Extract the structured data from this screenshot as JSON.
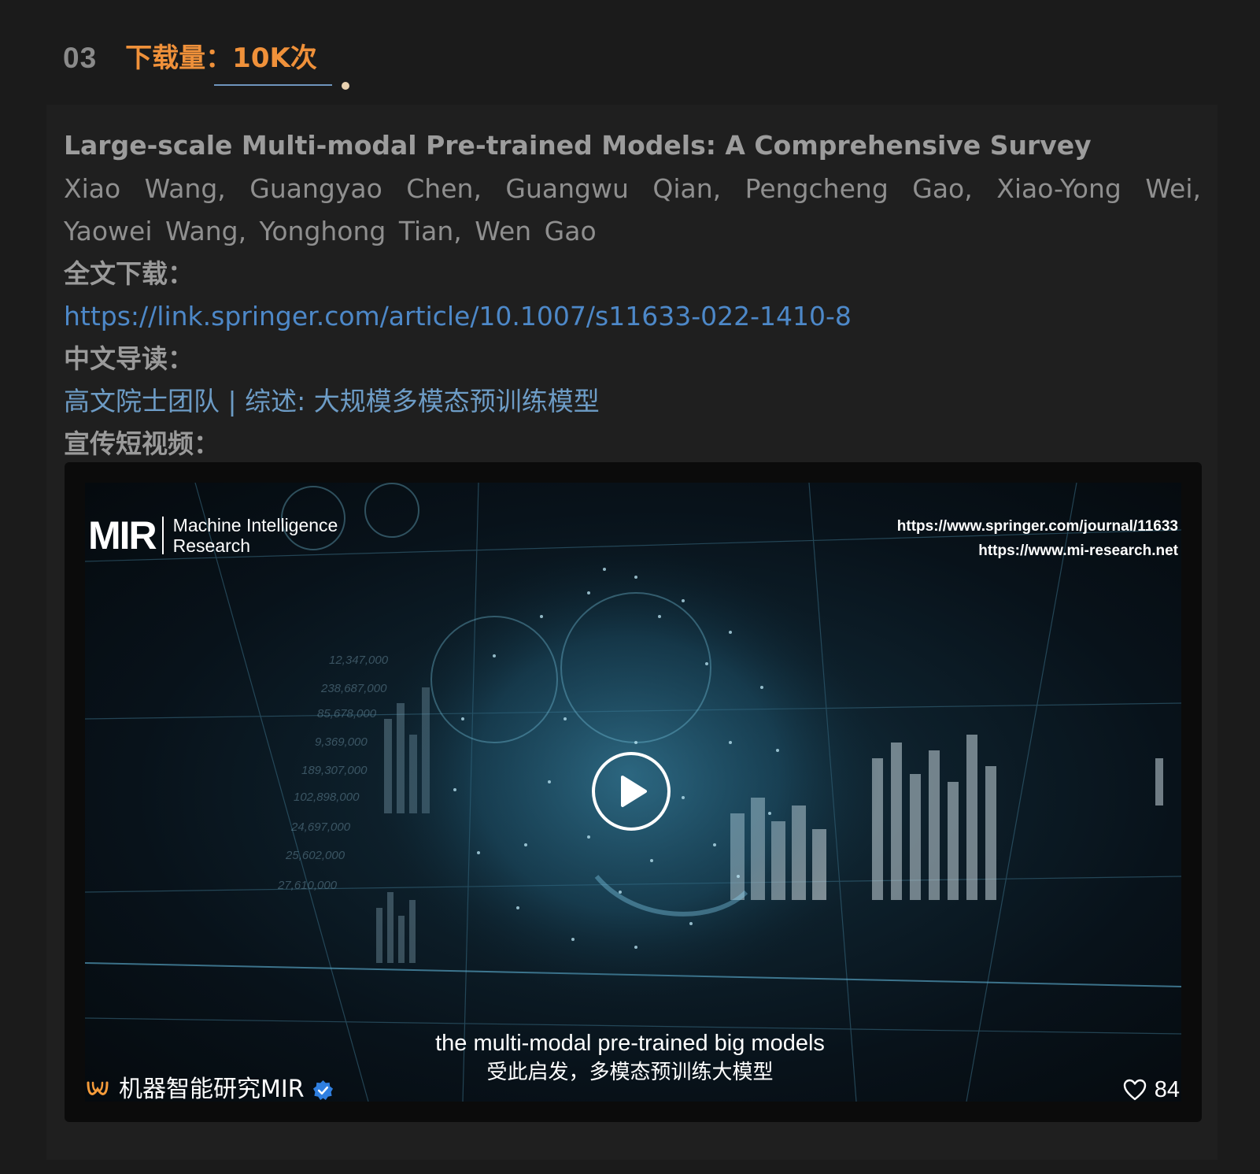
{
  "section": {
    "number": "03",
    "label": "下载量：",
    "value": "10K次"
  },
  "paper": {
    "title": "Large-scale Multi-modal Pre-trained Models: A Comprehensive Survey",
    "authors": "Xiao Wang, Guangyao Chen, Guangwu Qian, Pengcheng Gao, Xiao-Yong Wei, Yaowei Wang, Yonghong Tian, Wen Gao",
    "download_label": "全文下载：",
    "download_url": "https://link.springer.com/article/10.1007/s11633-022-1410-8",
    "guide_label": "中文导读：",
    "guide_text": "高文院士团队 | 综述: 大规模多模态预训练模型",
    "video_label": "宣传短视频："
  },
  "video": {
    "logo_mark": "MIR",
    "logo_name_line1": "Machine Intelligence",
    "logo_name_line2": "Research",
    "url_line1": "https://www.springer.com/journal/11633",
    "url_line2": "https://www.mi-research.net",
    "subtitle_en": "the multi-modal pre-trained big models",
    "subtitle_cn": "受此启发，多模态预训练大模型",
    "channel_name": "机器智能研究MIR",
    "likes": "84",
    "icons": {
      "play": "play-icon",
      "channel_logo": "channel-logo-icon",
      "verified": "verified-badge-icon",
      "like": "heart-icon"
    }
  },
  "colors": {
    "background": "#1b1b1b",
    "section_accent": "#f0913a",
    "link": "#4d88c8",
    "guide_link": "#6d9cc6",
    "verified": "#2f7fe0",
    "channel_logo": "#f59b3a"
  }
}
